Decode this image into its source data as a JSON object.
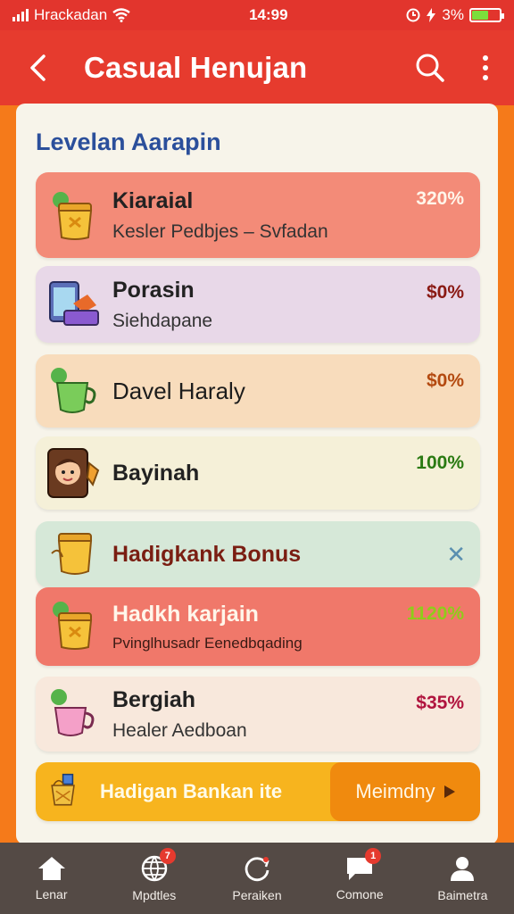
{
  "status_bar": {
    "carrier": "Hrackadan",
    "time": "14:99",
    "battery": "3%"
  },
  "app_bar": {
    "title": "Casual Henujan"
  },
  "section": {
    "title": "Levelan Aarapin"
  },
  "rows": [
    {
      "name": "Kiaraial",
      "sub": "Kesler Pedbjes – Svfadan",
      "pct": "320%",
      "icon": "honey-pot-icon"
    },
    {
      "name": "Porasin",
      "sub": "Siehdapane",
      "pct": "$0%",
      "icon": "tablet-gift-icon"
    },
    {
      "name": "Davel Haraly",
      "sub": "",
      "pct": "$0%",
      "icon": "green-teapot-icon"
    },
    {
      "name": "Bayinah",
      "sub": "",
      "pct": "100%",
      "icon": "girl-avatar-icon"
    },
    {
      "name": "Hadigkank Bonus",
      "sub": "",
      "pct": "",
      "icon": "honey-pot-icon"
    },
    {
      "name": "Hadkh karjain",
      "sub": "Pvinglhusadr Eenedbqading",
      "pct": "1120%",
      "icon": "honey-pot-icon"
    },
    {
      "name": "Bergiah",
      "sub": "Healer Aedboan",
      "pct": "$35%",
      "icon": "pink-teapot-icon"
    }
  ],
  "promo": {
    "label": "Hadigan Bankan ite",
    "button": "Meimdny"
  },
  "bottom_nav": [
    {
      "label": "Lenar",
      "icon": "home-icon",
      "badge": ""
    },
    {
      "label": "Mpdtles",
      "icon": "globe-icon",
      "badge": "7"
    },
    {
      "label": "Peraiken",
      "icon": "refresh-icon",
      "badge": ""
    },
    {
      "label": "Comone",
      "icon": "chat-icon",
      "badge": "1"
    },
    {
      "label": "Baimetra",
      "icon": "person-icon",
      "badge": ""
    }
  ],
  "colors": {
    "status_bar": "#e2352d",
    "app_bar": "#e63b2e",
    "page_bg": "#f57a1a",
    "nav_bg": "#544a45"
  }
}
